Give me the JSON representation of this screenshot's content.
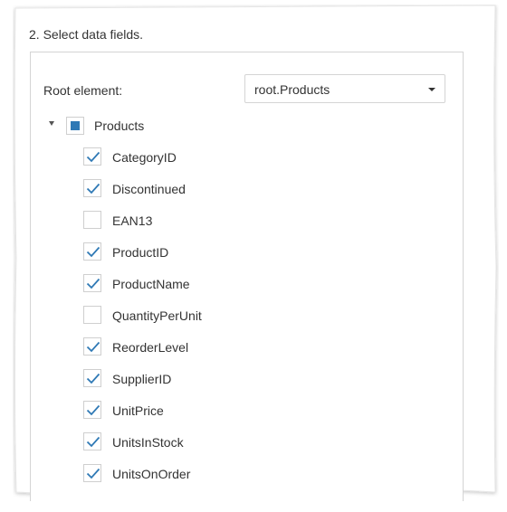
{
  "step": {
    "title": "2. Select data fields."
  },
  "root_element": {
    "label": "Root element:",
    "value": "root.Products"
  },
  "tree": {
    "root": {
      "label": "Products",
      "state": "partial"
    },
    "fields": [
      {
        "label": "CategoryID",
        "checked": true
      },
      {
        "label": "Discontinued",
        "checked": true
      },
      {
        "label": "EAN13",
        "checked": false
      },
      {
        "label": "ProductID",
        "checked": true
      },
      {
        "label": "ProductName",
        "checked": true
      },
      {
        "label": "QuantityPerUnit",
        "checked": false
      },
      {
        "label": "ReorderLevel",
        "checked": true
      },
      {
        "label": "SupplierID",
        "checked": true
      },
      {
        "label": "UnitPrice",
        "checked": true
      },
      {
        "label": "UnitsInStock",
        "checked": true
      },
      {
        "label": "UnitsOnOrder",
        "checked": true
      }
    ]
  },
  "colors": {
    "accent": "#2f79b5",
    "text": "#333333",
    "border": "#d4d4d4"
  }
}
